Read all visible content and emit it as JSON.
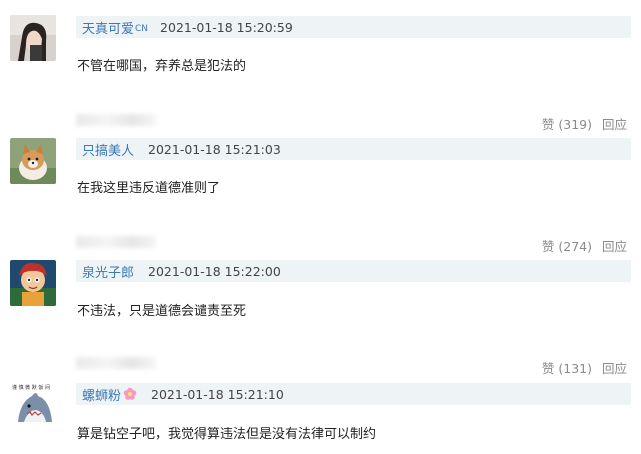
{
  "comments": [
    {
      "username": "天真可爱",
      "badge": "CN",
      "timestamp": "2021-01-18 15:20:59",
      "content": "不管在哪国，弃养总是犯法的",
      "likes_label": "赞 (319)",
      "reply_label": "回应"
    },
    {
      "username": "只搞美人",
      "timestamp": "2021-01-18 15:21:03",
      "content": "在我这里违反道德准则了",
      "likes_label": "赞 (274)",
      "reply_label": "回应"
    },
    {
      "username": "泉光子郎",
      "timestamp": "2021-01-18 15:22:00",
      "content": "不违法，只是道德会谴责至死",
      "likes_label": "赞 (131)",
      "reply_label": "回应"
    },
    {
      "username": "螺蛳粉",
      "timestamp": "2021-01-18 15:21:10",
      "content": "算是钻空子吧，我觉得算违法但是没有法律可以制约"
    }
  ],
  "avatar4_caption": "谨 慎 微 默 饭 间",
  "colors": {
    "meta_bar": "#eef3f5",
    "username": "#3b79b8",
    "action_text": "#8a8a8a"
  }
}
